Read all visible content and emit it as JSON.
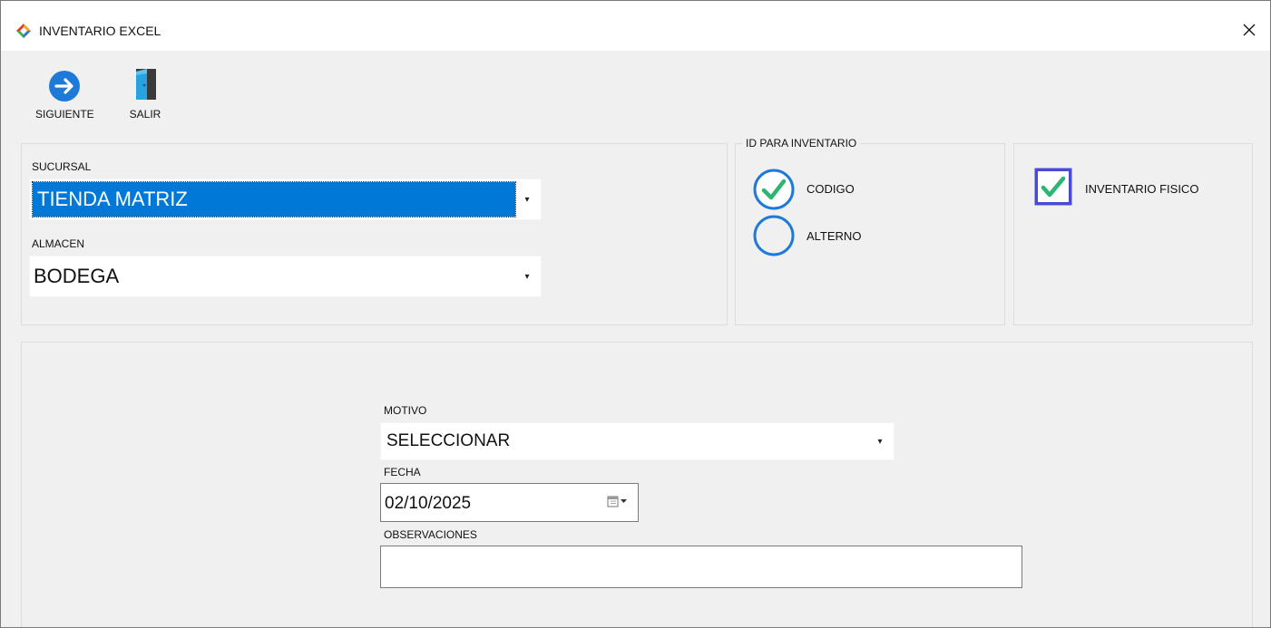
{
  "window": {
    "title": "INVENTARIO EXCEL",
    "icon": "app-diamond-icon",
    "close_icon": "close-icon"
  },
  "toolbar": {
    "next_label": "SIGUIENTE",
    "exit_label": "SALIR"
  },
  "location": {
    "sucursal_label": "SUCURSAL",
    "sucursal_value": "TIENDA MATRIZ",
    "almacen_label": "ALMACEN",
    "almacen_value": "BODEGA"
  },
  "id_group": {
    "title": "ID PARA INVENTARIO",
    "options": [
      {
        "label": "CODIGO",
        "checked": true
      },
      {
        "label": "ALTERNO",
        "checked": false
      }
    ]
  },
  "physical": {
    "label": "INVENTARIO FISICO",
    "checked": true
  },
  "details": {
    "motivo_label": "MOTIVO",
    "motivo_value": "SELECCIONAR",
    "fecha_label": "FECHA",
    "fecha_value": "02/10/2025",
    "observaciones_label": "OBSERVACIONES",
    "observaciones_value": ""
  },
  "colors": {
    "accent_blue": "#1e7ad8",
    "check_green": "#2bb673",
    "selection": "#0078d7"
  }
}
